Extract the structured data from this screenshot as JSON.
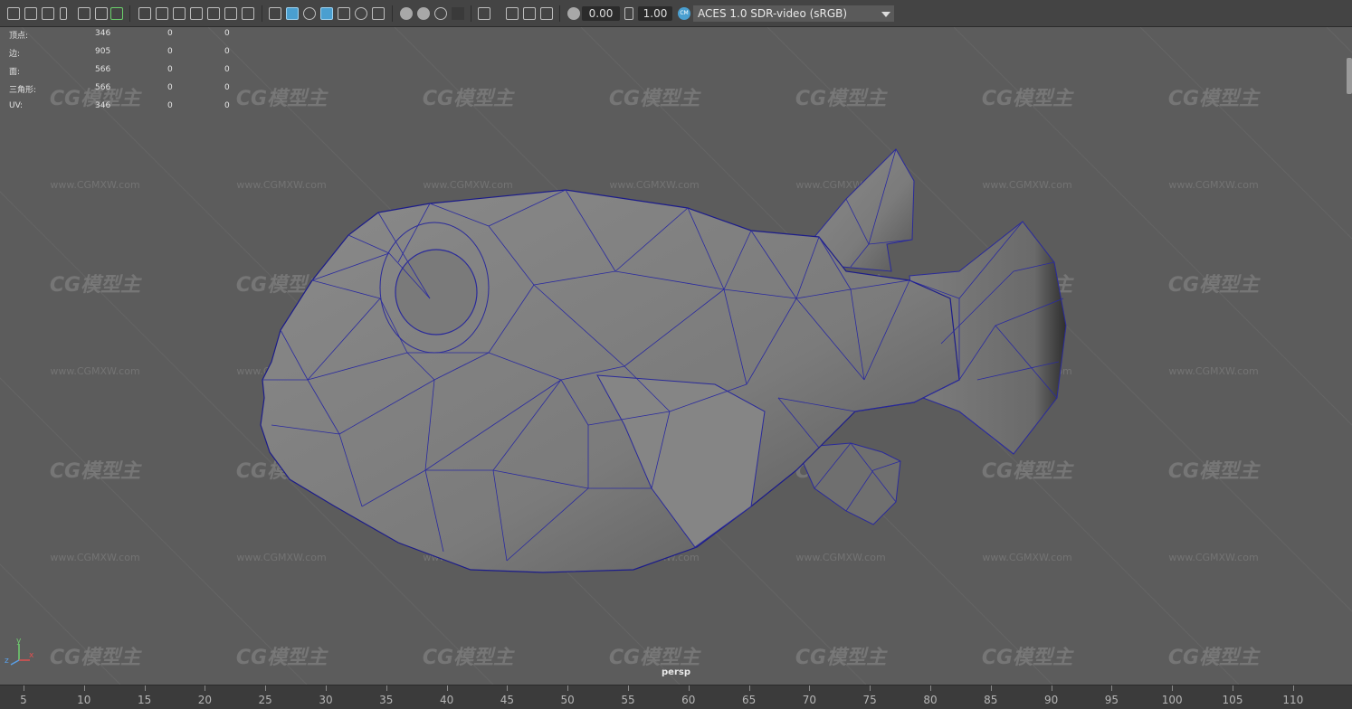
{
  "toolbar": {
    "exposure_value": "0.00",
    "gamma_value": "1.00",
    "color_space_label": "ACES 1.0 SDR-video (sRGB)",
    "color_space_badge": "CM"
  },
  "hud": {
    "rows": [
      {
        "label": "顶点:",
        "total": "346",
        "selected": "0",
        "components": "0"
      },
      {
        "label": "边:",
        "total": "905",
        "selected": "0",
        "components": "0"
      },
      {
        "label": "面:",
        "total": "566",
        "selected": "0",
        "components": "0"
      },
      {
        "label": "三角形:",
        "total": "566",
        "selected": "0",
        "components": "0"
      },
      {
        "label": "UV:",
        "total": "346",
        "selected": "0",
        "components": "0"
      }
    ]
  },
  "viewport": {
    "camera_name": "persp",
    "model_name": "low-poly pufferfish",
    "wireframe_color": "#1a1a8c",
    "background_color": "#5c5c5c",
    "axis_labels": [
      "x",
      "y",
      "z"
    ]
  },
  "watermarks": {
    "logo_text": "CG模型主",
    "url_text": "www.CGMXW.com"
  },
  "timeline": {
    "ticks": [
      "5",
      "10",
      "15",
      "20",
      "25",
      "30",
      "35",
      "40",
      "45",
      "50",
      "55",
      "60",
      "65",
      "70",
      "75",
      "80",
      "85",
      "90",
      "95",
      "100",
      "105",
      "110"
    ]
  }
}
